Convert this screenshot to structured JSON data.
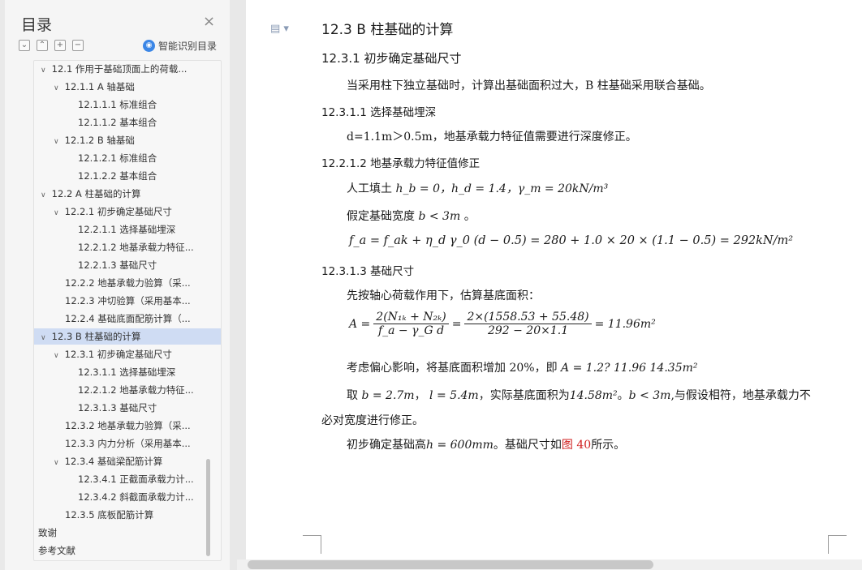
{
  "sidebar": {
    "title": "目录",
    "close": "×",
    "smart_label": "智能识别目录",
    "toc": [
      {
        "label": "12.1  作用于基础顶面上的荷载...",
        "indent": 0,
        "expanded": true
      },
      {
        "label": "12.1.1 A 轴基础",
        "indent": 1,
        "expanded": true
      },
      {
        "label": "12.1.1.1  标准组合",
        "indent": 2
      },
      {
        "label": "12.1.1.2  基本组合",
        "indent": 2
      },
      {
        "label": "12.1.2 B 轴基础",
        "indent": 1,
        "expanded": true
      },
      {
        "label": "12.1.2.1  标准组合",
        "indent": 2
      },
      {
        "label": "12.1.2.2  基本组合",
        "indent": 2
      },
      {
        "label": "12.2  A 柱基础的计算",
        "indent": 0,
        "expanded": true
      },
      {
        "label": "12.2.1  初步确定基础尺寸",
        "indent": 1,
        "expanded": true
      },
      {
        "label": "12.2.1.1  选择基础埋深",
        "indent": 2
      },
      {
        "label": "12.2.1.2  地基承载力特征...",
        "indent": 2
      },
      {
        "label": "12.2.1.3  基础尺寸",
        "indent": 2
      },
      {
        "label": "12.2.2  地基承载力验算（采...",
        "indent": 1
      },
      {
        "label": "12.2.3  冲切验算（采用基本...",
        "indent": 1
      },
      {
        "label": "12.2.4  基础底面配筋计算（...",
        "indent": 1
      },
      {
        "label": "12.3  B 柱基础的计算",
        "indent": 0,
        "expanded": true,
        "selected": true
      },
      {
        "label": "12.3.1  初步确定基础尺寸",
        "indent": 1,
        "expanded": true
      },
      {
        "label": "12.3.1.1  选择基础埋深",
        "indent": 2
      },
      {
        "label": "12.2.1.2  地基承载力特征...",
        "indent": 2
      },
      {
        "label": "12.3.1.3  基础尺寸",
        "indent": 2
      },
      {
        "label": "12.3.2  地基承载力验算（采...",
        "indent": 1
      },
      {
        "label": "12.3.3  内力分析（采用基本...",
        "indent": 1
      },
      {
        "label": "12.3.4  基础梁配筋计算",
        "indent": 1,
        "expanded": true
      },
      {
        "label": "12.3.4.1  正截面承载力计...",
        "indent": 2
      },
      {
        "label": "12.3.4.2  斜截面承载力计...",
        "indent": 2
      },
      {
        "label": "12.3.5  底板配筋计算",
        "indent": 1
      },
      {
        "label": "致谢",
        "indent": -1
      },
      {
        "label": "参考文献",
        "indent": -1
      }
    ]
  },
  "doc": {
    "h1": "12.3  B 柱基础的计算",
    "h2": "12.3.1  初步确定基础尺寸",
    "p1": "当采用柱下独立基础时，计算出基础面积过大，B 柱基础采用联合基础。",
    "h3a": "12.3.1.1  选择基础埋深",
    "p2": "d=1.1m＞0.5m，地基承载力特征值需要进行深度修正。",
    "h3b": "12.2.1.2  地基承载力特征值修正",
    "p3_prefix": "人工填土",
    "p3_math": "h_b = 0，h_d = 1.4，γ_m = 20kN/m³",
    "p4_prefix": "假定基础宽度",
    "p4_math": "b < 3m",
    "p4_suffix": "。",
    "eq1": "f_a = f_ak + η_d γ_0 (d − 0.5) = 280 + 1.0 × 20 × (1.1 − 0.5) = 292kN/m²",
    "h3c": "12.3.1.3  基础尺寸",
    "p5": "先按轴心荷载作用下，估算基底面积：",
    "eq2_lhs": "A =",
    "eq2_f1_num": "2(N₁ₖ + N₂ₖ)",
    "eq2_f1_den": "f_a − γ_G d",
    "eq2_f2_num": "2×(1558.53 + 55.48)",
    "eq2_f2_den": "292 − 20×1.1",
    "eq2_rhs": "= 11.96m²",
    "p6_prefix": "考虑偏心影响，将基底面积增加 20%，即",
    "p6_math": "A = 1.2? 11.96    14.35m²",
    "p7_prefix": "取",
    "p7_math1": "b = 2.7m",
    "p7_math2": "l = 5.4m",
    "p7_mid": "，实际基底面积为",
    "p7_math3": "14.58m²",
    "p7_math4": "b < 3m",
    "p7_suffix": "与假设相符，地基承载力不",
    "p8": "必对宽度进行修正。",
    "p9_prefix": "初步确定基础高",
    "p9_math": "h = 600mm",
    "p9_mid": "。基础尺寸如",
    "p9_link": "图 40",
    "p9_suffix": "所示。"
  }
}
